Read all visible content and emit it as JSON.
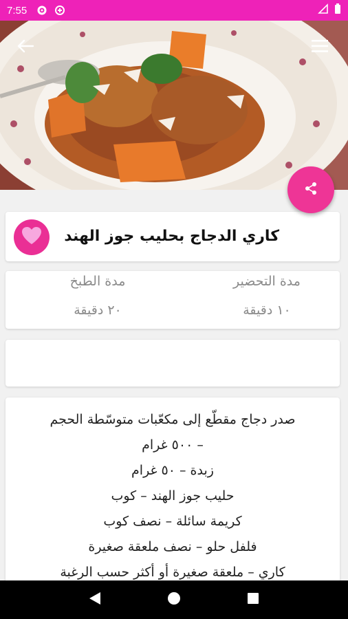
{
  "status_bar": {
    "time": "7:55",
    "icons": [
      "settings-icon",
      "data-saver-icon",
      "signal-icon",
      "battery-icon"
    ]
  },
  "hero": {
    "image_description_icon": "food-photo",
    "back_icon": "arrow-back-icon",
    "menu_icon": "hamburger-menu-icon"
  },
  "share_icon": "share-icon",
  "accent_color": "#ee22b8",
  "recipe": {
    "title": "كاري الدجاج بحليب جوز الهند",
    "favorite_icon": "heart-icon"
  },
  "times": {
    "prep_label": "مدة التحضير",
    "prep_value": "١٠ دقيقة",
    "cook_label": "مدة الطبخ",
    "cook_value": "٢٠ دقيقة"
  },
  "ingredients": [
    "صدر دجاج مقطّع إلى مكعّبات متوسّطة الحجم",
    "– ٥٠٠ غرام",
    "زبدة – ٥٠ غرام",
    "حليب جوز الهند – كوب",
    "كريمة سائلة – نصف كوب",
    "فلفل حلو – نصف ملعقة صغيرة",
    "كاري – ملعقة صغيرة أو أكثر حسب الرغبة"
  ],
  "nav_bar": {
    "icons": [
      "back-triangle-icon",
      "home-circle-icon",
      "recents-square-icon"
    ]
  }
}
